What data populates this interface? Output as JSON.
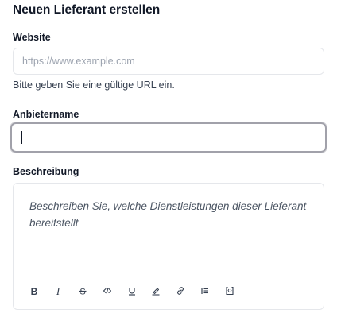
{
  "form": {
    "title": "Neuen Lieferant erstellen",
    "website": {
      "label": "Website",
      "placeholder": "https://www.example.com",
      "value": "",
      "hint": "Bitte geben Sie eine gültige URL ein."
    },
    "provider_name": {
      "label": "Anbietername",
      "value": "",
      "focused": true
    },
    "description": {
      "label": "Beschreibung",
      "placeholder": "Beschreiben Sie, welche Dienstleistungen dieser Lieferant bereitstellt",
      "toolbar": [
        {
          "name": "bold-icon"
        },
        {
          "name": "italic-icon"
        },
        {
          "name": "strikethrough-icon"
        },
        {
          "name": "code-icon"
        },
        {
          "name": "underline-icon"
        },
        {
          "name": "highlight-icon"
        },
        {
          "name": "link-icon"
        },
        {
          "name": "list-icon"
        },
        {
          "name": "code-block-icon"
        }
      ]
    }
  },
  "colors": {
    "text": "#111827",
    "placeholder": "#9ca3af",
    "border": "#e5e7eb",
    "focus_border": "#a1a1aa"
  }
}
